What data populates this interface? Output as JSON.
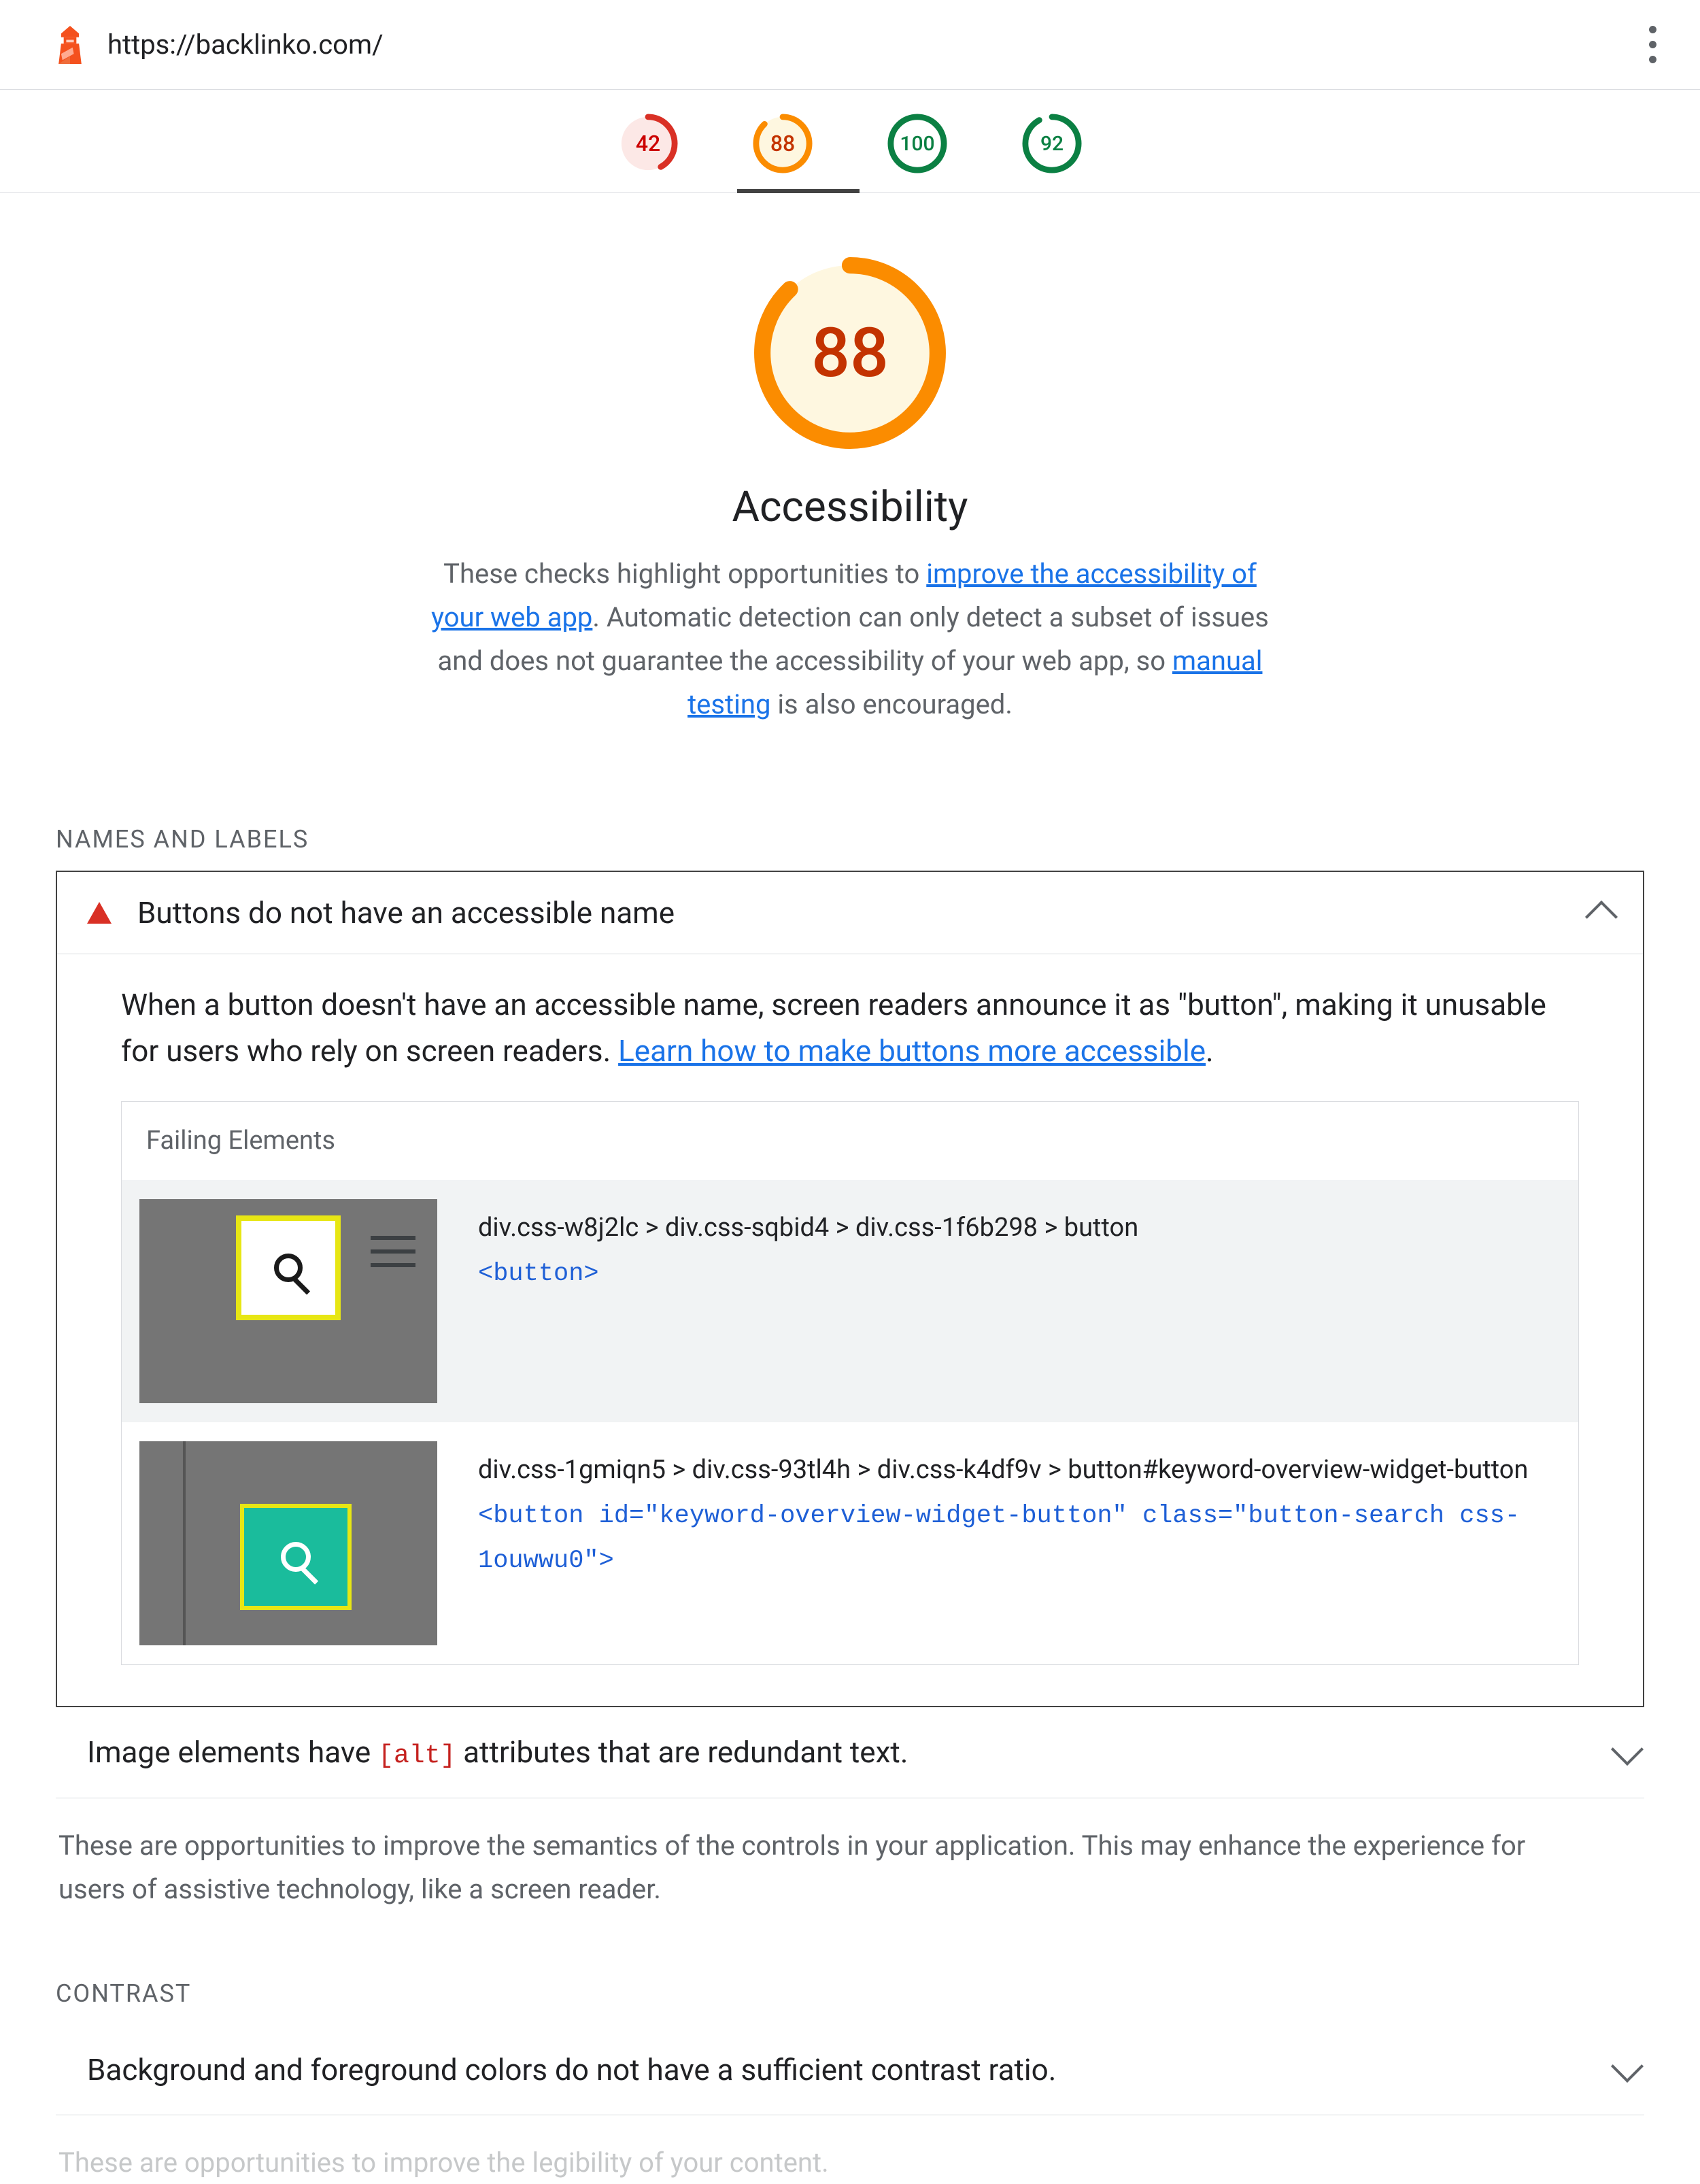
{
  "url": "https://backlinko.com/",
  "scores": {
    "performance": 42,
    "accessibility": 88,
    "best_practices": 100,
    "seo": 92,
    "active_tab_index": 1
  },
  "hero": {
    "score": 88,
    "title": "Accessibility",
    "desc_a": "These checks highlight opportunities to ",
    "link_a": "improve the accessibility of your web app",
    "desc_b": ". Automatic detection can only detect a subset of issues and does not guarantee the accessibility of your web app, so ",
    "link_b": "manual testing",
    "desc_c": " is also encouraged."
  },
  "group_names": {
    "names_labels": "NAMES AND LABELS",
    "contrast": "CONTRAST"
  },
  "audit1": {
    "title": "Buttons do not have an accessible name",
    "body_a": "When a button doesn't have an accessible name, screen readers announce it as \"button\", making it unusable for users who rely on screen readers. ",
    "body_link": "Learn how to make buttons more accessible",
    "body_b": ".",
    "failing_header": "Failing Elements",
    "items": [
      {
        "selector": "div.css-w8j2lc > div.css-sqbid4 > div.css-1f6b298 > button",
        "snippet": "<button>"
      },
      {
        "selector": "div.css-1gmiqn5 > div.css-93tl4h > div.css-k4df9v > button#keyword-overview-widget-button",
        "snippet": "<button id=\"keyword-overview-widget-button\" class=\"button-search css-1ouwwu0\">"
      }
    ]
  },
  "audit2": {
    "title_a": "Image elements have ",
    "title_code": "[alt]",
    "title_b": " attributes that are redundant text."
  },
  "names_note": "These are opportunities to improve the semantics of the controls in your application. This may enhance the experience for users of assistive technology, like a screen reader.",
  "audit3": {
    "title": "Background and foreground colors do not have a sufficient contrast ratio."
  },
  "contrast_note": "These are opportunities to improve the legibility of your content."
}
